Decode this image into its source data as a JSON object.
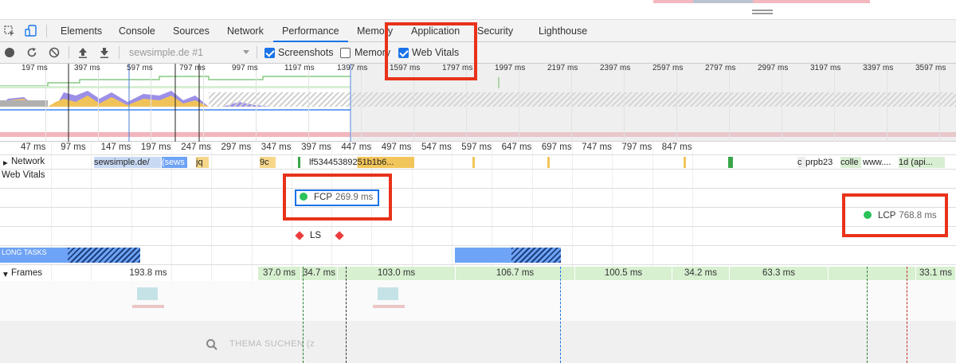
{
  "tabs": [
    {
      "label": "Elements"
    },
    {
      "label": "Console"
    },
    {
      "label": "Sources"
    },
    {
      "label": "Network"
    },
    {
      "label": "Performance"
    },
    {
      "label": "Memory"
    },
    {
      "label": "Application"
    },
    {
      "label": "Security"
    },
    {
      "label": "Lighthouse"
    }
  ],
  "toolbar": {
    "profile_select": "sewsimple.de #1",
    "screenshots_label": "Screenshots",
    "memory_label": "Memory",
    "web_vitals_label": "Web Vitals"
  },
  "overview": {
    "ticks": [
      "197 ms",
      "397 ms",
      "597 ms",
      "797 ms",
      "997 ms",
      "1197 ms",
      "1397 ms",
      "1597 ms",
      "1797 ms",
      "1997 ms",
      "2197 ms",
      "2397 ms",
      "2597 ms",
      "2797 ms",
      "2997 ms",
      "3197 ms",
      "3397 ms",
      "3597 ms"
    ]
  },
  "ruler": {
    "ticks": [
      "47 ms",
      "97 ms",
      "147 ms",
      "197 ms",
      "247 ms",
      "297 ms",
      "347 ms",
      "397 ms",
      "447 ms",
      "497 ms",
      "547 ms",
      "597 ms",
      "647 ms",
      "697 ms",
      "747 ms",
      "797 ms",
      "847 ms"
    ]
  },
  "network": {
    "label": "Network",
    "bars": [
      "sewsimple.de/",
      "(sews",
      "jq",
      "9c",
      "lf53445389251b1b6...",
      "c",
      "prpb23",
      "colle",
      "www....",
      "1d (api..."
    ]
  },
  "web_vitals": {
    "label": "Web Vitals",
    "fcp": {
      "name": "FCP",
      "value": "269.9 ms"
    },
    "lcp": {
      "name": "LCP",
      "value": "768.8 ms"
    },
    "ls": {
      "name": "LS"
    }
  },
  "long_tasks": {
    "label": "LONG TASKS"
  },
  "frames": {
    "label": "Frames",
    "items": [
      "193.8 ms",
      "37.0 ms",
      "34.7 ms",
      "103.0 ms",
      "106.7 ms",
      "100.5 ms",
      "34.2 ms",
      "63.3 ms",
      "33.1 ms"
    ]
  },
  "screenshot_strip": {
    "search_text": "THEMA SUCHEN (z"
  },
  "colors": {
    "accent": "#1a73e8",
    "highlight_box": "#e8321a",
    "fcp_lcp_dot": "#2bc25a",
    "layout_shift": "#ea3c3c",
    "frames_green": "#d7f0d0",
    "long_task": "#6ea3f5"
  }
}
